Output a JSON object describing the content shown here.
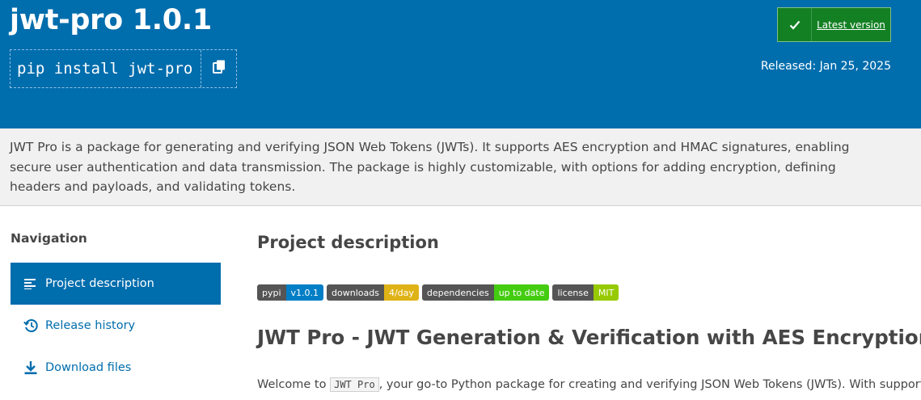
{
  "header": {
    "package_title": "jwt-pro 1.0.1",
    "pip_command": "pip install jwt-pro",
    "latest_version_label": "Latest version",
    "released": "Released: Jan 25, 2025"
  },
  "summary": "JWT Pro is a package for generating and verifying JSON Web Tokens (JWTs). It supports AES encryption and HMAC signatures, enabling secure user authentication and data transmission. The package is highly customizable, with options for adding encryption, defining headers and payloads, and validating tokens.",
  "navigation": {
    "heading": "Navigation",
    "items": [
      {
        "label": "Project description",
        "icon": "align-left-icon",
        "active": true
      },
      {
        "label": "Release history",
        "icon": "history-icon",
        "active": false
      },
      {
        "label": "Download files",
        "icon": "download-icon",
        "active": false
      }
    ]
  },
  "main": {
    "heading": "Project description",
    "badges": [
      {
        "left": "pypi",
        "right": "v1.0.1",
        "color": "#007ec6"
      },
      {
        "left": "downloads",
        "right": "4/day",
        "color": "#dfb317"
      },
      {
        "left": "dependencies",
        "right": "up to date",
        "color": "#4c1"
      },
      {
        "left": "license",
        "right": "MIT",
        "color": "#97ca00"
      }
    ],
    "readme_title": "JWT Pro - JWT Generation & Verification with AES Encryption",
    "readme_intro": {
      "before": "Welcome to ",
      "code": "JWT Pro",
      "after": ", your go-to Python package for creating and verifying JSON Web Tokens (JWTs). With support"
    }
  },
  "colors": {
    "banner": "#006dad",
    "latest_button": "#148024",
    "summary_bg": "#f1f1f1"
  }
}
